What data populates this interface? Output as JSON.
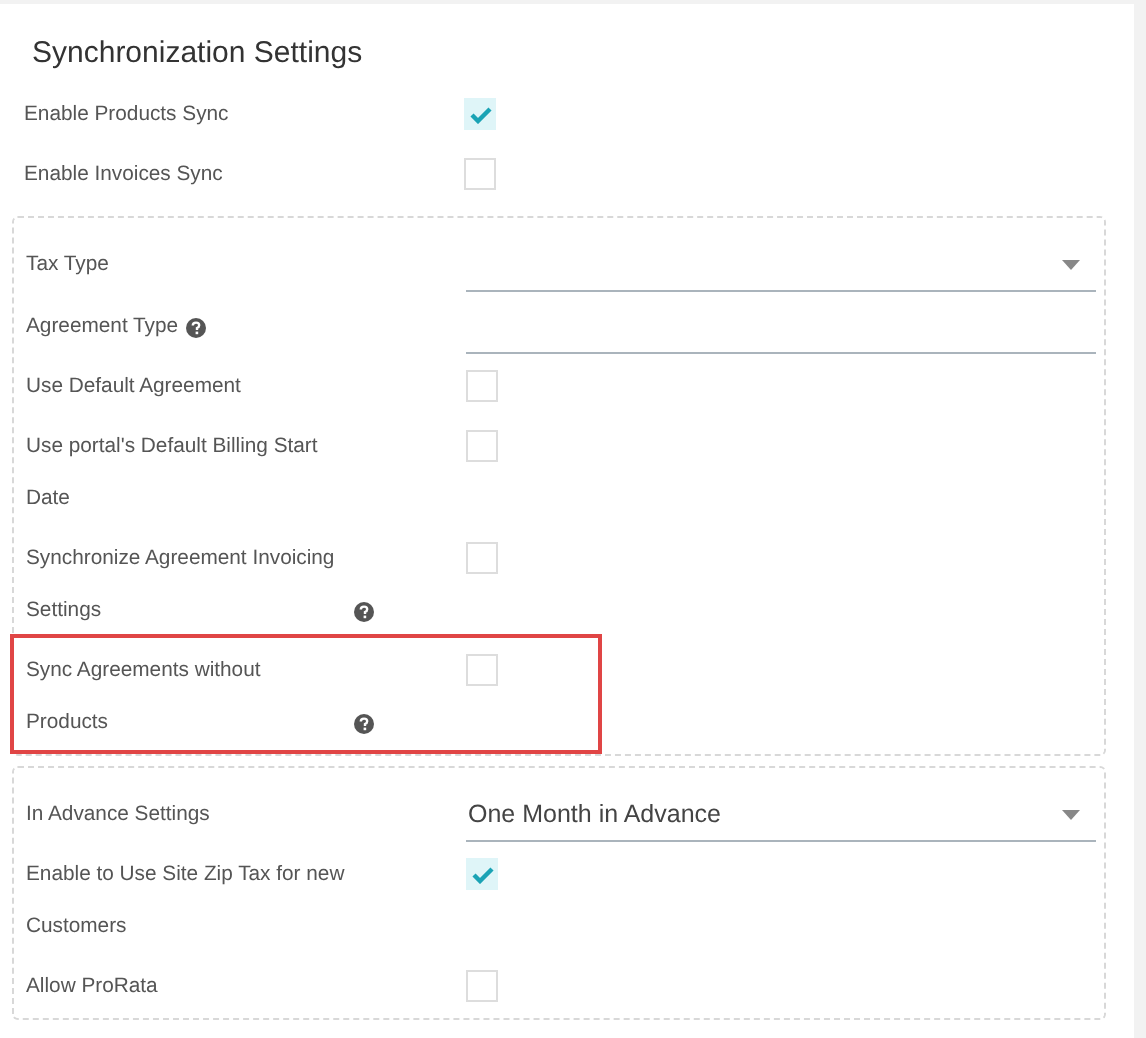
{
  "title": "Synchronization Settings",
  "sections": [
    {
      "bordered": false,
      "rows": [
        {
          "kind": "checkbox",
          "label": "Enable Products Sync",
          "help": false,
          "checked": true,
          "highlighted": false
        },
        {
          "kind": "checkbox",
          "label": "Enable Invoices Sync",
          "help": false,
          "checked": false,
          "highlighted": false
        }
      ]
    },
    {
      "bordered": true,
      "rows": [
        {
          "kind": "select",
          "label": "Tax Type",
          "help": false,
          "highlighted": false
        },
        {
          "kind": "text",
          "label": "Agreement Type",
          "help": true,
          "highlighted": false
        },
        {
          "kind": "checkbox",
          "label": "Use Default Agreement",
          "help": false,
          "checked": false,
          "highlighted": false
        },
        {
          "kind": "checkbox",
          "label": "Use portal's Default Billing Start Date",
          "help": false,
          "checked": false,
          "highlighted": false
        },
        {
          "kind": "checkbox",
          "label": "Synchronize Agreement Invoicing Settings",
          "help": true,
          "checked": false,
          "highlighted": false
        },
        {
          "kind": "checkbox",
          "label": "Sync Agreements without Products",
          "help": true,
          "checked": false,
          "highlighted": true
        }
      ]
    },
    {
      "bordered": true,
      "rows": [
        {
          "kind": "select",
          "label": "In Advance Settings",
          "help": false,
          "value": "One Month in Advance",
          "highlighted": false
        },
        {
          "kind": "checkbox",
          "label": "Enable to Use Site Zip Tax for new Customers",
          "help": false,
          "checked": true,
          "highlighted": false
        },
        {
          "kind": "checkbox",
          "label": "Allow ProRata",
          "help": false,
          "checked": false,
          "highlighted": false
        }
      ]
    }
  ]
}
